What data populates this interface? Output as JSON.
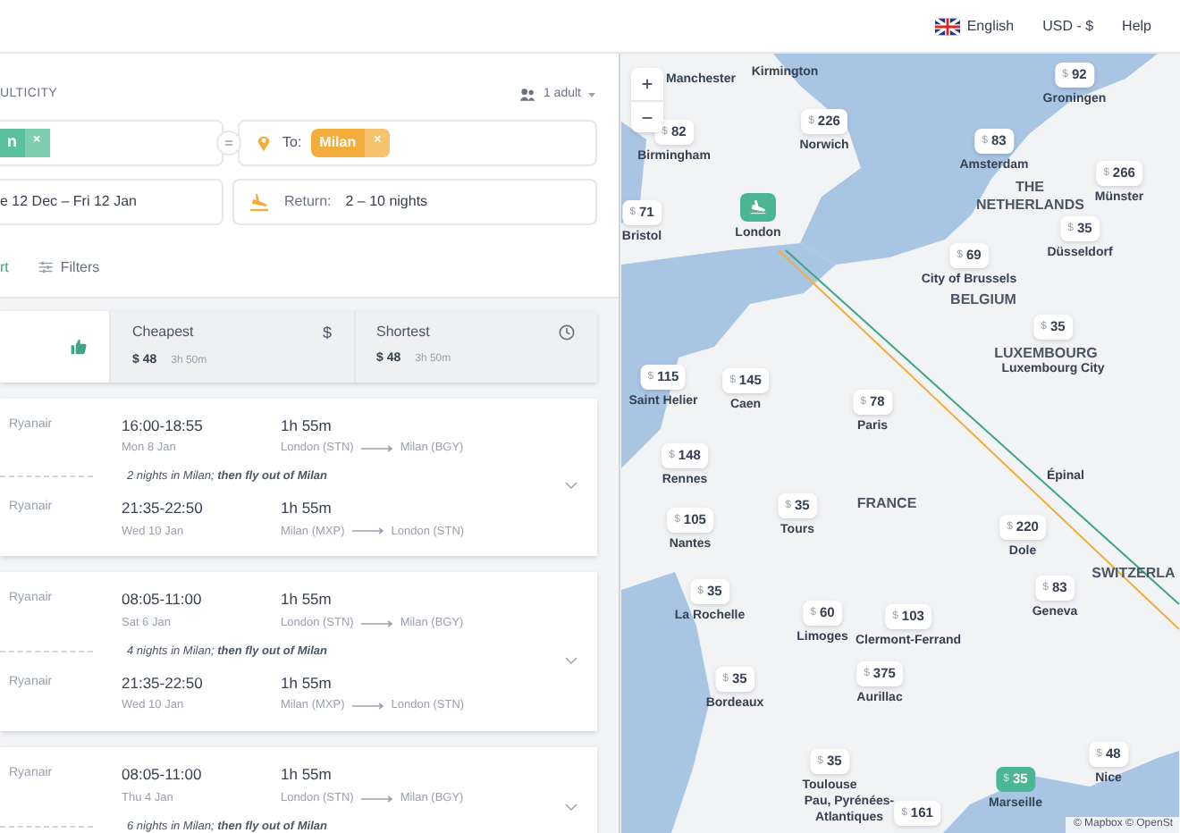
{
  "header": {
    "language": "English",
    "currency": "USD - $",
    "help": "Help"
  },
  "search": {
    "trip_type": "ULTICITY",
    "passengers": "1 adult",
    "from_chip": "n",
    "from_chip_remove": "×",
    "to_chip_remove": "×",
    "to_label": "To:",
    "to_chip": "Milan",
    "dates": "e 12 Dec – Fri 12 Jan",
    "return_label": "Return:",
    "return_value": "2 – 10 nights",
    "sort_link": "rt",
    "filters": "Filters"
  },
  "sort_tabs": [
    {
      "kind": "best",
      "selected": true
    },
    {
      "kind": "cheapest",
      "label": "Cheapest",
      "icon": "$",
      "price": "$ 48",
      "duration": "3h 50m",
      "selected": false
    },
    {
      "kind": "shortest",
      "label": "Shortest",
      "price": "$ 48",
      "duration": "3h 50m",
      "selected": false
    }
  ],
  "results": [
    {
      "legs": [
        {
          "airline": "Ryanair",
          "times": "16:00-18:55",
          "date": "Mon 8 Jan",
          "duration": "1h 55m",
          "from": "London (STN)",
          "to": "Milan (BGY)"
        },
        {
          "airline": "Ryanair",
          "times": "21:35-22:50",
          "date": "Wed 10 Jan",
          "duration": "1h 55m",
          "from": "Milan (MXP)",
          "to": "London (STN)"
        }
      ],
      "stay": "2 nights in Milan; **then fly out of Milan**"
    },
    {
      "legs": [
        {
          "airline": "Ryanair",
          "times": "08:05-11:00",
          "date": "Sat 6 Jan",
          "duration": "1h 55m",
          "from": "London (STN)",
          "to": "Milan (BGY)"
        },
        {
          "airline": "Ryanair",
          "times": "21:35-22:50",
          "date": "Wed 10 Jan",
          "duration": "1h 55m",
          "from": "Milan (MXP)",
          "to": "London (STN)"
        }
      ],
      "stay": "4 nights in Milan; **then fly out of Milan**"
    },
    {
      "legs": [
        {
          "airline": "Ryanair",
          "times": "08:05-11:00",
          "date": "Thu 4 Jan",
          "duration": "1h 55m",
          "from": "London (STN)",
          "to": "Milan (BGY)"
        }
      ],
      "stay": "6 nights in Milan; **then fly out of Milan**"
    }
  ],
  "map": {
    "labels": [
      {
        "text": "Manchester",
        "kind": "city"
      },
      {
        "text": "Kirmington",
        "kind": "city"
      },
      {
        "text": "THE NETHERLANDS",
        "kind": "country"
      },
      {
        "text": "BELGIUM",
        "kind": "country"
      },
      {
        "text": "LUXEMBOURG",
        "kind": "country"
      },
      {
        "text": "FRANCE",
        "kind": "country"
      },
      {
        "text": "Épinal",
        "kind": "city"
      },
      {
        "text": "SWITZERLA",
        "kind": "country"
      },
      {
        "text": "Pau, Pyrénées-Atlantiques",
        "kind": "city"
      }
    ],
    "pins": [
      {
        "kind": "price",
        "currency": "$",
        "price": "82",
        "city": "Birmingham",
        "selected": false
      },
      {
        "kind": "price",
        "currency": "$",
        "price": "226",
        "city": "Norwich",
        "selected": false
      },
      {
        "kind": "price",
        "currency": "$",
        "price": "92",
        "city": "Groningen",
        "selected": false
      },
      {
        "kind": "price",
        "currency": "$",
        "price": "83",
        "city": "Amsterdam",
        "selected": false
      },
      {
        "kind": "price",
        "currency": "$",
        "price": "266",
        "city": "Münster",
        "selected": false
      },
      {
        "kind": "price",
        "currency": "$",
        "price": "35",
        "city": "Düsseldorf",
        "selected": false
      },
      {
        "kind": "price",
        "currency": "$",
        "price": "71",
        "city": "Bristol",
        "selected": false
      },
      {
        "kind": "origin",
        "city": "London",
        "selected": true
      },
      {
        "kind": "price",
        "currency": "$",
        "price": "69",
        "city": "City of Brussels",
        "selected": false
      },
      {
        "kind": "price",
        "currency": "$",
        "price": "35",
        "city": "Luxembourg City",
        "selected": false
      },
      {
        "kind": "price",
        "currency": "$",
        "price": "115",
        "city": "Saint Helier",
        "selected": false
      },
      {
        "kind": "price",
        "currency": "$",
        "price": "145",
        "city": "Caen",
        "selected": false
      },
      {
        "kind": "price",
        "currency": "$",
        "price": "78",
        "city": "Paris",
        "selected": false
      },
      {
        "kind": "price",
        "currency": "$",
        "price": "148",
        "city": "Rennes",
        "selected": false
      },
      {
        "kind": "price",
        "currency": "$",
        "price": "105",
        "city": "Nantes",
        "selected": false
      },
      {
        "kind": "price",
        "currency": "$",
        "price": "35",
        "city": "Tours",
        "selected": false
      },
      {
        "kind": "price",
        "currency": "$",
        "price": "220",
        "city": "Dole",
        "selected": false
      },
      {
        "kind": "price",
        "currency": "$",
        "price": "35",
        "city": "La Rochelle",
        "selected": false
      },
      {
        "kind": "price",
        "currency": "$",
        "price": "60",
        "city": "Limoges",
        "selected": false
      },
      {
        "kind": "price",
        "currency": "$",
        "price": "103",
        "city": "Clermont-Ferrand",
        "selected": false
      },
      {
        "kind": "price",
        "currency": "$",
        "price": "83",
        "city": "Geneva",
        "selected": false
      },
      {
        "kind": "price",
        "currency": "$",
        "price": "35",
        "city": "Bordeaux",
        "selected": false
      },
      {
        "kind": "price",
        "currency": "$",
        "price": "375",
        "city": "Aurillac",
        "selected": false
      },
      {
        "kind": "price",
        "currency": "$",
        "price": "35",
        "city": "Toulouse",
        "selected": false
      },
      {
        "kind": "price",
        "currency": "$",
        "price": "48",
        "city": "Nice",
        "selected": false
      },
      {
        "kind": "price",
        "currency": "$",
        "price": "35",
        "city": "Marseille",
        "selected": true
      },
      {
        "kind": "price",
        "currency": "$",
        "price": "161",
        "selected": false
      }
    ],
    "attribution": "© Mapbox © OpenSt"
  }
}
